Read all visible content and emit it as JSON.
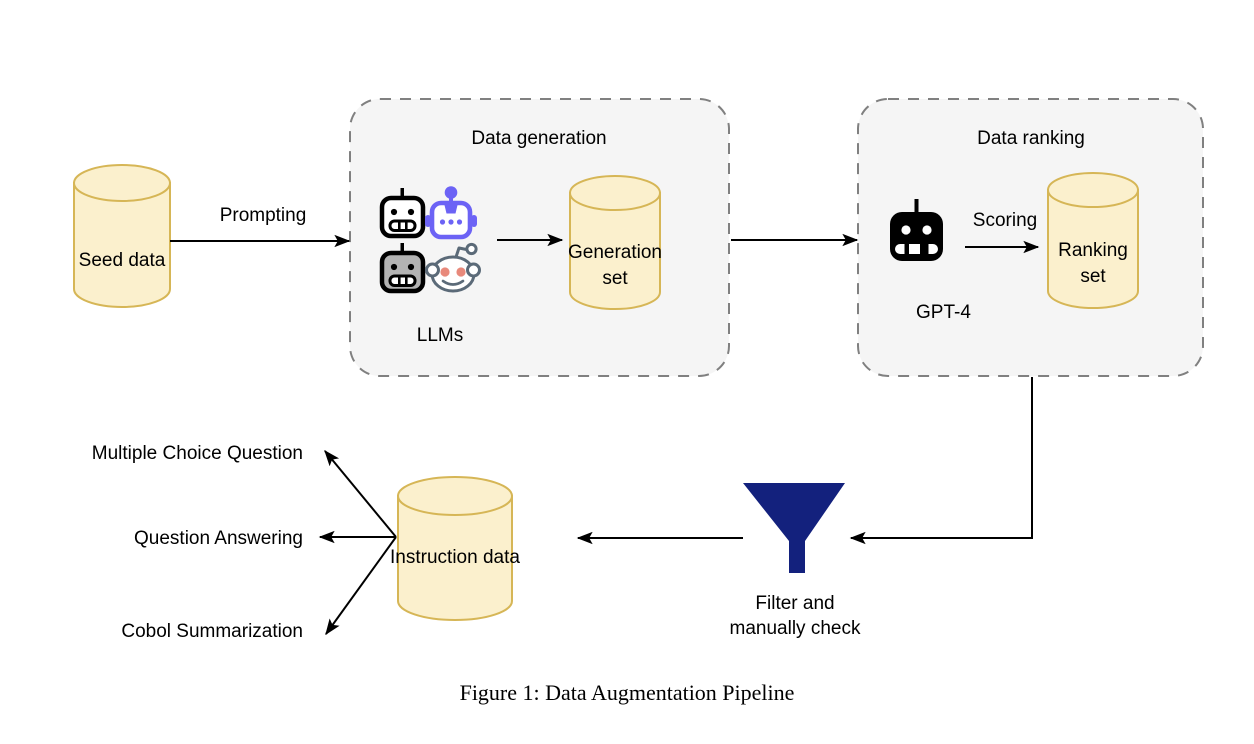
{
  "figure": {
    "caption": "Figure 1: Data Augmentation Pipeline",
    "background_color": "#ffffff"
  },
  "palette": {
    "cylinder_fill": "#fbf0cd",
    "cylinder_stroke": "#d6b656",
    "group_fill": "#f5f5f5",
    "group_stroke": "#808080",
    "line": "#000000",
    "funnel": "#13217d",
    "robot_black": "#000000",
    "robot_gray": "#b3b3b3",
    "robot_purple": "#6c63f5",
    "reddit_outline": "#5b6a78",
    "reddit_cheek": "#e8897b"
  },
  "nodes": {
    "seed_data": {
      "label": "Seed data"
    },
    "generation_set": {
      "label_line1": "Generation",
      "label_line2": "set"
    },
    "ranking_set": {
      "label_line1": "Ranking",
      "label_line2": "set"
    },
    "instruction_data": {
      "label": "Instruction data"
    }
  },
  "groups": {
    "data_generation": {
      "title": "Data generation",
      "models_label": "LLMs",
      "model_icons": [
        {
          "name": "robot-black-icon",
          "color": "#000000"
        },
        {
          "name": "robot-purple-icon",
          "color": "#6c63f5"
        },
        {
          "name": "robot-gray-icon",
          "color": "#b3b3b3"
        },
        {
          "name": "reddit-snoo-icon",
          "color": "#5b6a78"
        }
      ]
    },
    "data_ranking": {
      "title": "Data ranking",
      "model_label": "GPT-4",
      "model_icon": "robot-black-icon"
    }
  },
  "edges": {
    "prompting": "Prompting",
    "scoring": "Scoring"
  },
  "filter": {
    "icon": "funnel-icon",
    "caption_line1": "Filter and",
    "caption_line2": "manually check",
    "color": "#13217d"
  },
  "tasks": [
    {
      "label": "Multiple Choice Question"
    },
    {
      "label": "Question Answering"
    },
    {
      "label": "Cobol Summarization"
    }
  ]
}
